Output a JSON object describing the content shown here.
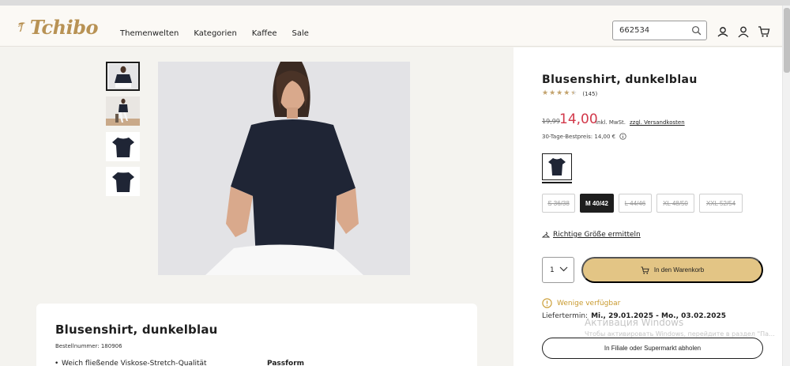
{
  "header": {
    "logo_text": "Tchibo",
    "nav": [
      "Themenwelten",
      "Kategorien",
      "Kaffee",
      "Sale"
    ],
    "search_value": "662534",
    "icons": [
      "search-icon",
      "account-icon",
      "user-icon",
      "cart-icon"
    ]
  },
  "gallery": {
    "thumbnails": [
      "thumbnail-front-model",
      "thumbnail-full-body-model",
      "thumbnail-product-front",
      "thumbnail-product-back"
    ],
    "active_thumbnail": 0
  },
  "product": {
    "title": "Blusenshirt, dunkelblau",
    "rating": 4.5,
    "review_count": "(145)",
    "old_price": "19,99",
    "price": "14,00",
    "vat_note": "inkl. MwSt.",
    "shipping_link": "zzgl. Versandkosten",
    "best_price": "30-Tage-Bestpreis: 14,00 €",
    "sizes": [
      {
        "label": "S 36/38",
        "state": "unavailable"
      },
      {
        "label": "M 40/42",
        "state": "selected"
      },
      {
        "label": "L 44/46",
        "state": "unavailable"
      },
      {
        "label": "XL 48/50",
        "state": "unavailable"
      },
      {
        "label": "XXL 52/54",
        "state": "unavailable"
      }
    ],
    "size_finder": "Richtige Größe ermitteln",
    "quantity": "1",
    "add_to_cart": "In den Warenkorb",
    "availability": "Wenige verfügbar",
    "delivery_label": "Liefertermin:",
    "delivery_dates": "Mi., 29.01.2025 - Mo., 03.02.2025",
    "store_pickup": "In Filiale oder Supermarkt abholen"
  },
  "details": {
    "title": "Blusenshirt, dunkelblau",
    "order_number": "Bestellnummer: 180906",
    "bullet_1": "Weich fließende Viskose-Stretch-Qualität",
    "passform_label": "Passform"
  },
  "overlay": {
    "line1": "Активация Windows",
    "line2": "Чтобы активировать Windows, перейдите в раздел \"Па..."
  },
  "colors": {
    "accent_gold": "#e3c585",
    "logo_gold": "#b89254",
    "sale_red": "#d2384a",
    "availability_amber": "#c99a2e",
    "garment_navy": "#1f2535"
  }
}
